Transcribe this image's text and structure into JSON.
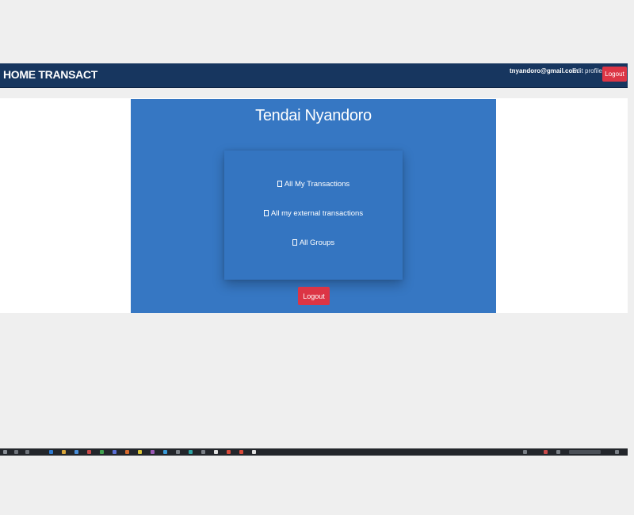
{
  "navbar": {
    "brand": "HOME TRANSACT",
    "email": "tnyandoro@gmail.com",
    "edit_profile": "Edit profile",
    "logout": "Logout"
  },
  "profile": {
    "name": "Tendai Nyandoro",
    "links": [
      {
        "label": "All My Transactions",
        "icon": "square-icon"
      },
      {
        "label": "All my external transactions",
        "icon": "square-icon"
      },
      {
        "label": "All Groups",
        "icon": "square-icon"
      }
    ],
    "logout": "Logout"
  },
  "colors": {
    "navbar": "#17365f",
    "panel": "#3677c3",
    "danger": "#dc3545",
    "background": "#efefef"
  }
}
